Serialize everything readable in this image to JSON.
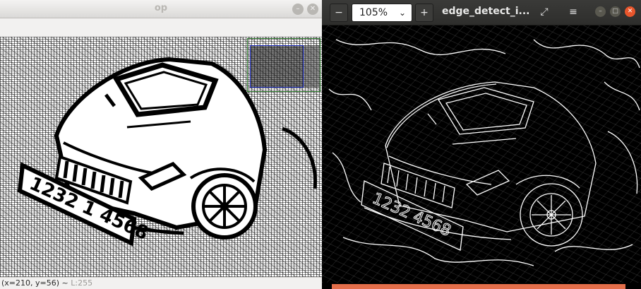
{
  "left_window": {
    "title": "op",
    "status": {
      "coords": "(x=210, y=56) ~",
      "pixel_value": "L:255"
    },
    "plate_text": "1232 1 4568"
  },
  "right_window": {
    "zoom": "105%",
    "title": "edge_detect_i...",
    "plate_text": "1232 4568",
    "accent_color": "#e46e4a"
  },
  "icons": {
    "zoom_out": "minus-icon",
    "zoom_dropdown": "chevron-down-icon",
    "zoom_in": "plus-icon",
    "fullscreen": "expand-icon",
    "menu": "hamburger-menu-icon",
    "minimize": "minimize-icon",
    "maximize": "maximize-icon",
    "close": "close-icon"
  }
}
